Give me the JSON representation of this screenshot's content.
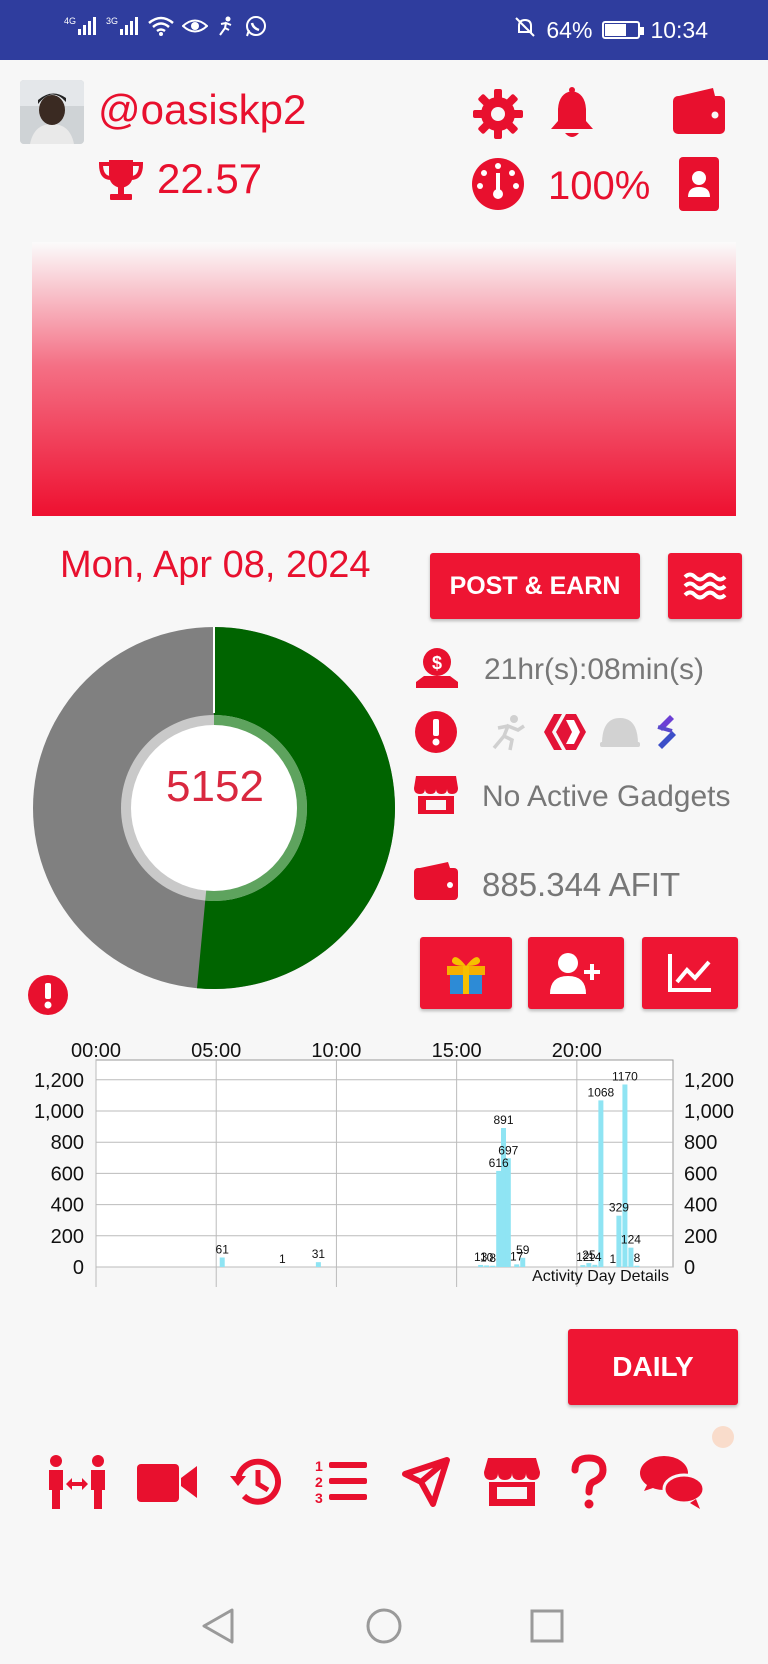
{
  "status_bar": {
    "network_1": "4G",
    "network_2": "3G",
    "battery": "64%",
    "battery_level": 0.64,
    "time": "10:34"
  },
  "profile": {
    "username": "@oasiskp2",
    "score": "22.57",
    "percent": "100%"
  },
  "icons": {
    "settings": "gear-icon",
    "notifications": "bell-icon",
    "wallet": "wallet-icon",
    "gauge": "gauge-icon",
    "profile_card": "contact-card-icon",
    "trophy": "trophy-icon"
  },
  "date": "Mon, Apr 08, 2024",
  "buttons": {
    "post_earn": "POST & EARN",
    "daily": "DAILY"
  },
  "info": {
    "timer": "21hr(s):08min(s)",
    "gadgets": "No Active Gadgets",
    "balance": "885.344 AFIT"
  },
  "donut": {
    "value": "5152",
    "progress": 0.515,
    "colors": {
      "progress": "#006400",
      "remaining": "#808080"
    }
  },
  "chart_data": {
    "type": "bar",
    "title": "Activity Day Details",
    "x_ticks": [
      "00:00",
      "05:00",
      "10:00",
      "15:00",
      "20:00"
    ],
    "y_ticks": [
      "0",
      "200",
      "400",
      "600",
      "800",
      "1,000",
      "1,200"
    ],
    "ylim": [
      0,
      1250
    ],
    "xlim_hours": [
      0,
      24
    ],
    "bar_color": "#8fe4f3",
    "points": [
      {
        "x": 5.25,
        "y": 61,
        "label": "61"
      },
      {
        "x": 7.75,
        "y": 1,
        "label": "1"
      },
      {
        "x": 9.25,
        "y": 31,
        "label": "31"
      },
      {
        "x": 16.0,
        "y": 13,
        "label": "13"
      },
      {
        "x": 16.25,
        "y": 10,
        "label": "10"
      },
      {
        "x": 16.5,
        "y": 8,
        "label": "8"
      },
      {
        "x": 16.75,
        "y": 616,
        "label": "616"
      },
      {
        "x": 16.95,
        "y": 891,
        "label": "891"
      },
      {
        "x": 17.15,
        "y": 697,
        "label": "697"
      },
      {
        "x": 17.5,
        "y": 17,
        "label": "17"
      },
      {
        "x": 17.75,
        "y": 59,
        "label": "59"
      },
      {
        "x": 20.25,
        "y": 12,
        "label": "12"
      },
      {
        "x": 20.5,
        "y": 25,
        "label": "25"
      },
      {
        "x": 20.75,
        "y": 14,
        "label": "14"
      },
      {
        "x": 21.0,
        "y": 1068,
        "label": "1068"
      },
      {
        "x": 21.5,
        "y": 1,
        "label": "1"
      },
      {
        "x": 21.75,
        "y": 329,
        "label": "329"
      },
      {
        "x": 22.0,
        "y": 1170,
        "label": "1170"
      },
      {
        "x": 22.25,
        "y": 124,
        "label": "124"
      },
      {
        "x": 22.5,
        "y": 8,
        "label": "8"
      }
    ]
  },
  "bottom_nav": [
    "transfer-people-icon",
    "video-camera-icon",
    "history-icon",
    "ordered-list-icon",
    "share-nodes-icon",
    "store-icon",
    "help-question-icon",
    "chat-bubbles-icon"
  ]
}
